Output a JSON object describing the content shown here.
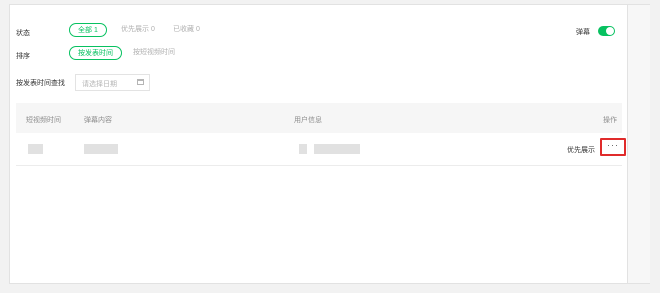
{
  "filters": {
    "status": {
      "label": "状态",
      "options": [
        "全部 1",
        "优先展示 0",
        "已收藏 0"
      ],
      "selected": "全部 1"
    },
    "sort": {
      "label": "排序",
      "options": [
        "按发表时间",
        "按短视频时间"
      ],
      "selected": "按发表时间"
    },
    "date_search": {
      "label": "按发表时间查找",
      "placeholder": "请选择日期"
    },
    "danmu_toggle": {
      "label": "弹幕",
      "on": true
    }
  },
  "table": {
    "headers": [
      "短视频时间",
      "弹幕内容",
      "用户信息",
      "操作"
    ],
    "rows": [
      {
        "action": "优先展示",
        "more": "···"
      }
    ]
  },
  "colors": {
    "accent": "#07c160",
    "highlight_border": "#e02b2b"
  },
  "icons": {
    "date_picker": "calendar-icon",
    "row_more": "more-dots-icon"
  }
}
